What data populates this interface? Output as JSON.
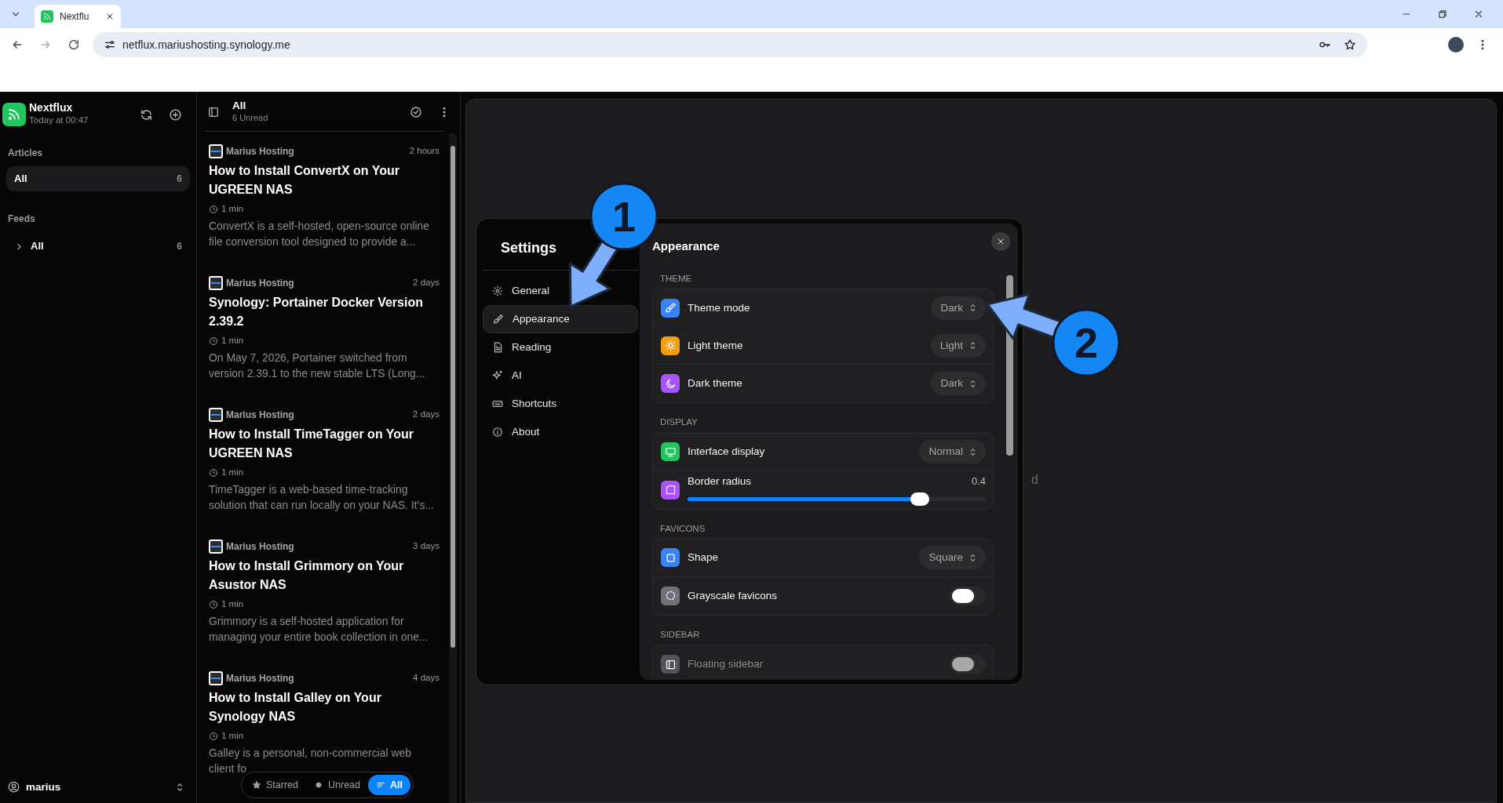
{
  "browser": {
    "tab_title": "Nextflu",
    "url": "netflux.mariushosting.synology.me"
  },
  "sidebar": {
    "app_name": "Nextflux",
    "updated": "Today at 00:47",
    "articles_heading": "Articles",
    "article_items": [
      {
        "label": "All",
        "count": "6",
        "selected": true
      }
    ],
    "feeds_heading": "Feeds",
    "feed_items": [
      {
        "label": "All",
        "count": "6",
        "expanded": false,
        "selected": false
      }
    ],
    "user": "marius"
  },
  "article_list": {
    "title": "All",
    "subtitle": "6 Unread",
    "articles": [
      {
        "source": "Marius Hosting",
        "age": "2 hours",
        "title": "How to Install ConvertX on Your UGREEN NAS",
        "read_time": "1 min",
        "excerpt": "ConvertX is a self-hosted, open-source online file conversion tool designed to provide a..."
      },
      {
        "source": "Marius Hosting",
        "age": "2 days",
        "title": "Synology: Portainer Docker Version 2.39.2",
        "read_time": "1 min",
        "excerpt": "On May 7, 2026, Portainer switched from version 2.39.1 to the new stable LTS (Long..."
      },
      {
        "source": "Marius Hosting",
        "age": "2 days",
        "title": "How to Install TimeTagger on Your UGREEN NAS",
        "read_time": "1 min",
        "excerpt": "TimeTagger is a web-based time-tracking solution that can run locally on your NAS. It’s..."
      },
      {
        "source": "Marius Hosting",
        "age": "3 days",
        "title": "How to Install Grimmory on Your Asustor NAS",
        "read_time": "1 min",
        "excerpt": "Grimmory is a self-hosted application for managing your entire book collection in one..."
      },
      {
        "source": "Marius Hosting",
        "age": "4 days",
        "title": "How to Install Galley on Your Synology NAS",
        "read_time": "1 min",
        "excerpt": "Galley is a personal, non-commercial web client fo"
      }
    ],
    "filters": [
      {
        "label": "Starred",
        "selected": false
      },
      {
        "label": "Unread",
        "selected": false
      },
      {
        "label": "All",
        "selected": true
      }
    ]
  },
  "reader": {
    "background_text": "d"
  },
  "settings": {
    "title": "Settings",
    "nav": [
      {
        "label": "General",
        "selected": false
      },
      {
        "label": "Appearance",
        "selected": true
      },
      {
        "label": "Reading",
        "selected": false
      },
      {
        "label": "AI",
        "selected": false
      },
      {
        "label": "Shortcuts",
        "selected": false
      },
      {
        "label": "About",
        "selected": false
      }
    ],
    "panel_title": "Appearance",
    "sections": [
      {
        "heading": "THEME",
        "rows": [
          {
            "kind": "select",
            "label": "Theme mode",
            "value": "Dark",
            "color": "#3b82f6"
          },
          {
            "kind": "select",
            "label": "Light theme",
            "value": "Light",
            "color": "#f59e0b"
          },
          {
            "kind": "select",
            "label": "Dark theme",
            "value": "Dark",
            "color": "#a855f7"
          }
        ]
      },
      {
        "heading": "DISPLAY",
        "rows": [
          {
            "kind": "select",
            "label": "Interface display",
            "value": "Normal",
            "color": "#22c55e"
          },
          {
            "kind": "slider",
            "label": "Border radius",
            "reading": "0.4",
            "level": 0.78,
            "color": "#a855f7"
          }
        ]
      },
      {
        "heading": "FAVICONS",
        "rows": [
          {
            "kind": "select",
            "label": "Shape",
            "value": "Square",
            "color": "#3b82f6"
          },
          {
            "kind": "toggle",
            "label": "Grayscale favicons",
            "on": false,
            "disabled": false,
            "color": "#71717a"
          }
        ]
      },
      {
        "heading": "SIDEBAR",
        "rows": [
          {
            "kind": "toggle",
            "label": "Floating sidebar",
            "on": false,
            "disabled": true,
            "color": "#52525b"
          }
        ]
      }
    ]
  },
  "annotations": [
    {
      "label": "1"
    },
    {
      "label": "2"
    }
  ]
}
